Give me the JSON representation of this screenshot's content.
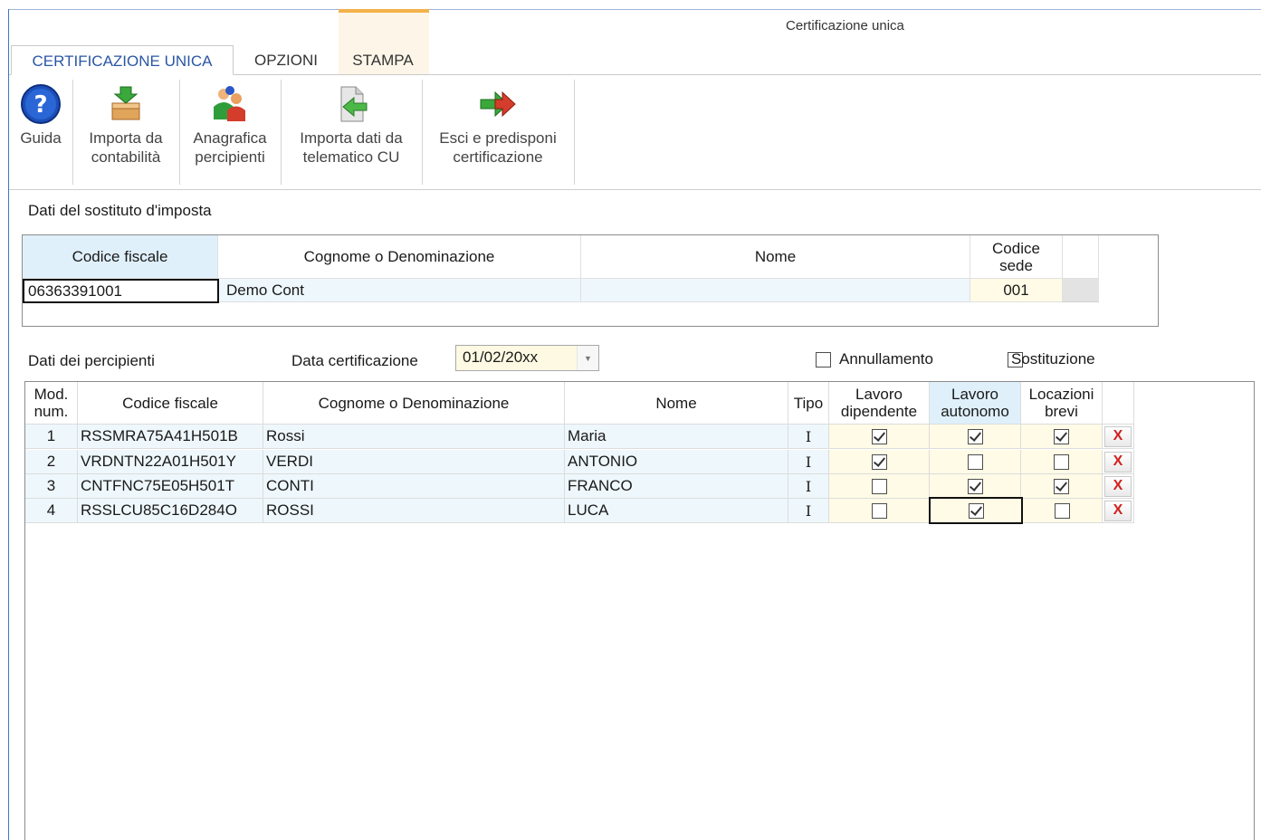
{
  "window": {
    "title": "Certificazione unica"
  },
  "ribbon": {
    "tabs": [
      {
        "label": "CERTIFICAZIONE UNICA",
        "active": true
      },
      {
        "label": "OPZIONI",
        "active": false
      },
      {
        "label": "STAMPA",
        "active": false
      }
    ],
    "buttons": [
      {
        "label_line1": "Guida",
        "label_line2": "",
        "icon": "help-icon"
      },
      {
        "label_line1": "Importa da",
        "label_line2": "contabilità",
        "icon": "import-box-icon"
      },
      {
        "label_line1": "Anagrafica",
        "label_line2": "percipienti",
        "icon": "people-icon"
      },
      {
        "label_line1": "Importa dati da",
        "label_line2": "telematico CU",
        "icon": "import-file-icon"
      },
      {
        "label_line1": "Esci e predisponi",
        "label_line2": "certificazione",
        "icon": "exit-arrow-icon"
      }
    ]
  },
  "sostituto": {
    "section_label": "Dati del sostituto d'imposta",
    "headers": {
      "codice_fiscale": "Codice fiscale",
      "cognome": "Cognome o Denominazione",
      "nome": "Nome",
      "codice_sede_l1": "Codice",
      "codice_sede_l2": "sede"
    },
    "row": {
      "codice_fiscale": "06363391001",
      "cognome": "Demo Cont",
      "nome": "",
      "codice_sede": "001"
    }
  },
  "percipienti": {
    "section_label": "Dati dei percipienti",
    "data_label": "Data certificazione",
    "data_value": "01/02/20xx",
    "annullamento_label": "Annullamento",
    "annullamento_checked": false,
    "sostituzione_label": "Sostituzione",
    "sostituzione_checked": false,
    "headers": {
      "mod_l1": "Mod.",
      "mod_l2": "num.",
      "codice_fiscale": "Codice fiscale",
      "cognome": "Cognome o Denominazione",
      "nome": "Nome",
      "tipo": "Tipo",
      "dip_l1": "Lavoro",
      "dip_l2": "dipendente",
      "aut_l1": "Lavoro",
      "aut_l2": "autonomo",
      "loc_l1": "Locazioni",
      "loc_l2": "brevi"
    },
    "delete_label": "X",
    "rows": [
      {
        "num": "1",
        "cf": "RSSMRA75A41H501B",
        "cognome": "Rossi",
        "nome": "Maria",
        "tipo": "I",
        "dip": true,
        "aut": true,
        "loc": true
      },
      {
        "num": "2",
        "cf": "VRDNTN22A01H501Y",
        "cognome": "VERDI",
        "nome": "ANTONIO",
        "tipo": "I",
        "dip": true,
        "aut": false,
        "loc": false
      },
      {
        "num": "3",
        "cf": "CNTFNC75E05H501T",
        "cognome": "CONTI",
        "nome": "FRANCO",
        "tipo": "I",
        "dip": false,
        "aut": true,
        "loc": true
      },
      {
        "num": "4",
        "cf": "RSSLCU85C16D284O",
        "cognome": "ROSSI",
        "nome": "LUCA",
        "tipo": "I",
        "dip": false,
        "aut": true,
        "loc": false
      }
    ]
  }
}
